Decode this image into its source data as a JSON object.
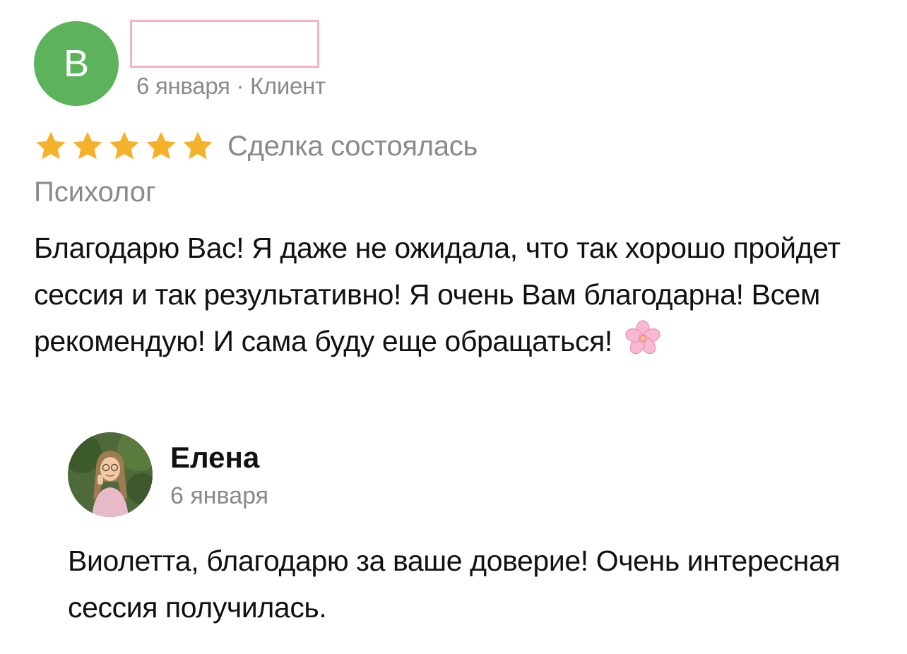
{
  "review": {
    "avatar_letter": "В",
    "meta": "6 января · Клиент",
    "rating": 5,
    "star_color": "#f6b12b",
    "avatar_color": "#5cb35c",
    "deal_status": "Сделка состоялась",
    "service": "Психолог",
    "text": "Благодарю Вас! Я даже не ожидала, что так хорошо пройдет сессия и так результативно! Я очень Вам благодарна! Всем рекомендую! И сама буду еще обращаться!",
    "emoji": "cherry-blossom-icon"
  },
  "reply": {
    "name": "Елена",
    "date": "6 января",
    "text": "Виолетта, благодарю за ваше доверие! Очень интересная сессия получилась."
  }
}
